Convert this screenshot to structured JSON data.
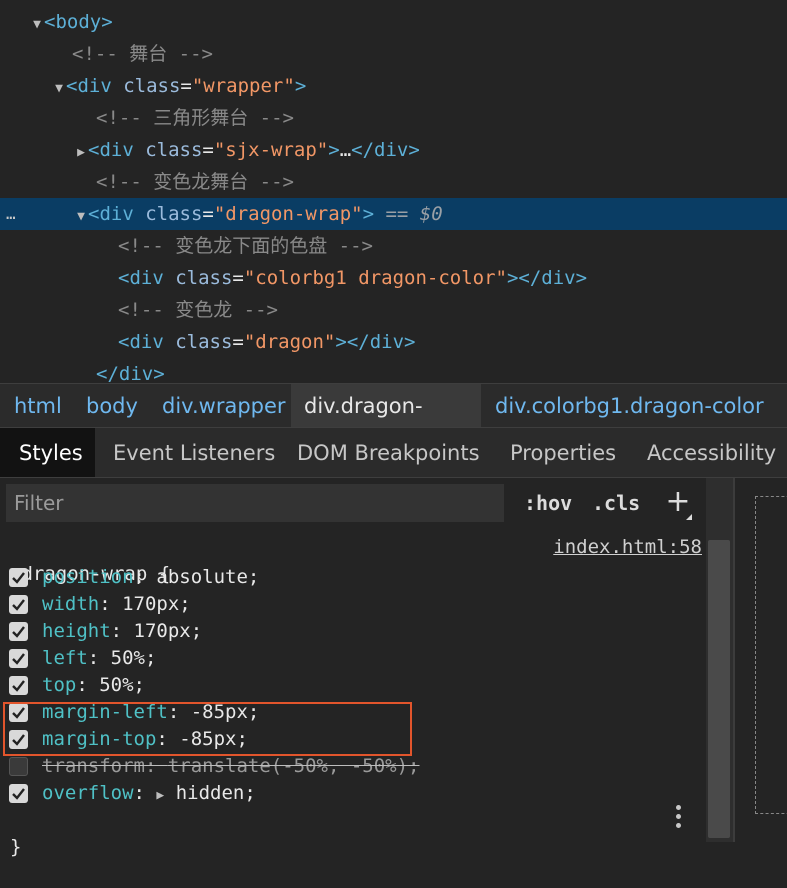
{
  "dom_tree": {
    "lines": [
      {
        "tag_open": "<body>"
      },
      {
        "comment": "<!-- 舞台 -->"
      },
      {
        "tag_start": "<div ",
        "attr": "class",
        "eq": "=",
        "value": "\"wrapper\"",
        "tag_end": ">"
      },
      {
        "comment": "<!-- 三角形舞台 -->"
      },
      {
        "tag_start": "<div ",
        "attr": "class",
        "eq": "=",
        "value": "\"sjx-wrap\"",
        "tag_end": ">",
        "ellipsis": "…",
        "close": "</div>"
      },
      {
        "comment": "<!-- 变色龙舞台 -->"
      },
      {
        "tag_start": "<div ",
        "attr": "class",
        "eq": "=",
        "value": "\"dragon-wrap\"",
        "tag_end": ">",
        "suffix": " == $0"
      },
      {
        "comment": "<!-- 变色龙下面的色盘 -->"
      },
      {
        "tag_start": "<div ",
        "attr": "class",
        "eq": "=",
        "value": "\"colorbg1 dragon-color\"",
        "tag_end": ">",
        "close": "</div>"
      },
      {
        "comment": "<!-- 变色龙 -->"
      },
      {
        "tag_start": "<div ",
        "attr": "class",
        "eq": "=",
        "value": "\"dragon\"",
        "tag_end": ">",
        "close": "</div>"
      },
      {
        "close_only": "</div>"
      }
    ],
    "selected_marker": "…"
  },
  "breadcrumb": [
    "html",
    "body",
    "div.wrapper",
    "div.dragon-wrap",
    "div.colorbg1.dragon-color"
  ],
  "tabs": [
    "Styles",
    "Event Listeners",
    "DOM Breakpoints",
    "Properties",
    "Accessibility"
  ],
  "filter": {
    "placeholder": "Filter",
    "hov": ":hov",
    "cls": ".cls",
    "plus": "+"
  },
  "rule": {
    "selector": ".dragon-wrap {",
    "source": "index.html:58",
    "close": "}",
    "declarations": [
      {
        "prop": "position",
        "value": "absolute;",
        "checked": true
      },
      {
        "prop": "width",
        "value": "170px;",
        "checked": true
      },
      {
        "prop": "height",
        "value": "170px;",
        "checked": true
      },
      {
        "prop": "left",
        "value": "50%;",
        "checked": true
      },
      {
        "prop": "top",
        "value": "50%;",
        "checked": true
      },
      {
        "prop": "margin-left",
        "value": "-85px;",
        "checked": true
      },
      {
        "prop": "margin-top",
        "value": "-85px;",
        "checked": true
      },
      {
        "prop": "transform",
        "value": "translate(-50%, -50%);",
        "checked": false
      },
      {
        "prop": "overflow",
        "value": "hidden;",
        "checked": true,
        "expandable": "▶"
      }
    ]
  },
  "colors": {
    "selection": "#0a3d64",
    "highlight": "#e2552c",
    "property": "#4fc1c6"
  }
}
